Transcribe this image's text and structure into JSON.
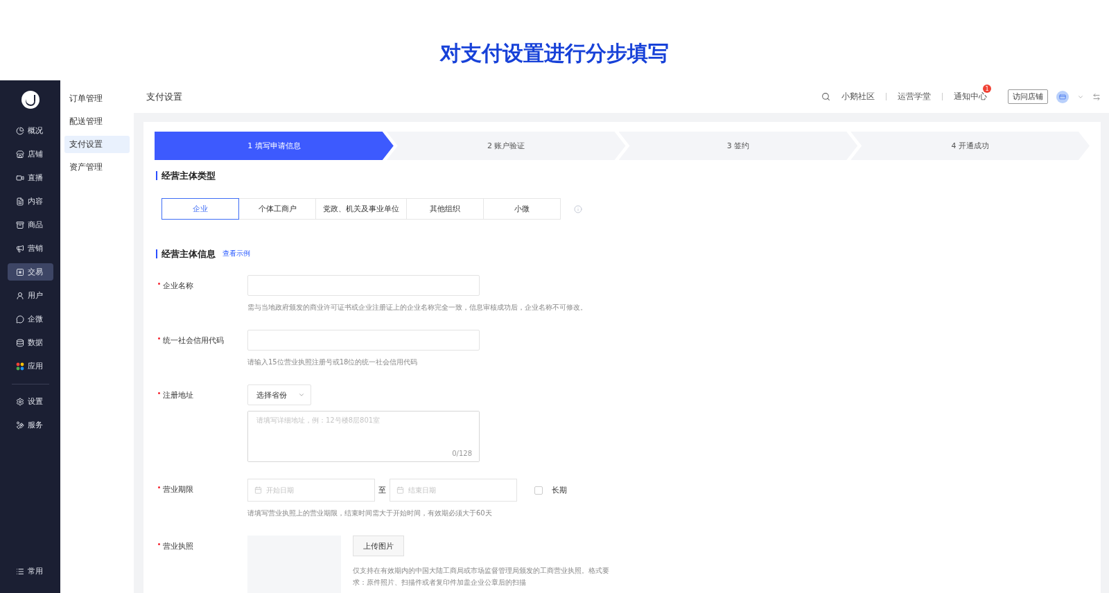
{
  "banner_title": "对支付设置进行分步填写",
  "sidebar": {
    "items": [
      {
        "label": "概况",
        "selected": false
      },
      {
        "label": "店铺",
        "selected": false
      },
      {
        "label": "直播",
        "selected": false
      },
      {
        "label": "内容",
        "selected": false
      },
      {
        "label": "商品",
        "selected": false
      },
      {
        "label": "营销",
        "selected": false
      },
      {
        "label": "交易",
        "selected": true
      },
      {
        "label": "用户",
        "selected": false
      },
      {
        "label": "企微",
        "selected": false
      },
      {
        "label": "数据",
        "selected": false
      },
      {
        "label": "应用",
        "selected": false
      }
    ],
    "bottom_items": [
      {
        "label": "设置",
        "selected": false
      },
      {
        "label": "服务",
        "selected": false
      }
    ],
    "footer": {
      "label": "常用"
    }
  },
  "submenu": [
    {
      "label": "订单管理",
      "selected": false
    },
    {
      "label": "配送管理",
      "selected": false
    },
    {
      "label": "支付设置",
      "selected": true
    },
    {
      "label": "资产管理",
      "selected": false
    }
  ],
  "topbar": {
    "title": "支付设置",
    "links": [
      "小鹅社区",
      "运营学堂",
      "通知中心"
    ],
    "badge": "1",
    "visit_button": "访问店铺"
  },
  "steps": [
    {
      "label": "1 填写申请信息",
      "selected": true
    },
    {
      "label": "2 账户验证",
      "selected": false
    },
    {
      "label": "3 签约",
      "selected": false
    },
    {
      "label": "4 开通成功",
      "selected": false
    }
  ],
  "entity_type": {
    "title": "经营主体类型",
    "options": [
      {
        "label": "企业",
        "selected": true
      },
      {
        "label": "个体工商户",
        "selected": false
      },
      {
        "label": "党政、机关及事业单位",
        "selected": false
      },
      {
        "label": "其他组织",
        "selected": false
      },
      {
        "label": "小微",
        "selected": false
      }
    ]
  },
  "entity_info": {
    "title": "经营主体信息",
    "link": "查看示例"
  },
  "fields": [
    {
      "kind": "text",
      "required": true,
      "label": "企业名称",
      "hint": "需与当地政府颁发的商业许可证书或企业注册证上的企业名称完全一致，信息审核成功后，企业名称不可修改。"
    },
    {
      "kind": "text",
      "required": true,
      "label": "统一社会信用代码",
      "hint": "请输入15位营业执照注册号或18位的统一社会信用代码"
    },
    {
      "kind": "address",
      "required": true,
      "label": "注册地址",
      "select": "选择省份",
      "placeholder": "请填写详细地址，例：12号楼8层801室",
      "counter": "0/128"
    },
    {
      "kind": "daterange",
      "required": true,
      "label": "营业期限",
      "start_placeholder": "开始日期",
      "separator": "至",
      "end_placeholder": "结束日期",
      "checkbox": {
        "label": "长期",
        "checked": false
      },
      "hint": "请填写营业执照上的营业期限，结束时间需大于开始时间，有效期必须大于60天"
    },
    {
      "kind": "upload",
      "required": true,
      "label": "营业执照",
      "button": "上传图片",
      "hint": "仅支持在有效期内的中国大陆工商局或市场监督管理局颁发的工商营业执照。格式要求：原件照片、扫描件或者复印件加盖企业公章后的扫描"
    }
  ]
}
